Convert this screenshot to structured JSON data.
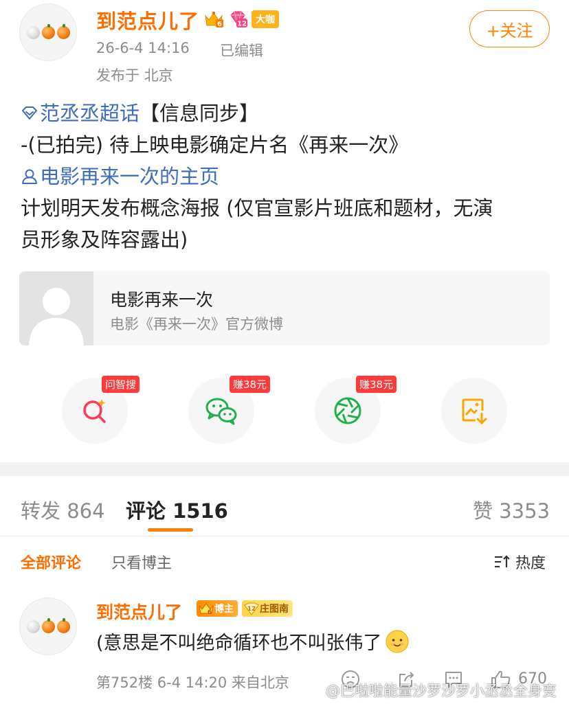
{
  "post": {
    "username": "到范点儿了",
    "badge_level": "6",
    "badge_vip": "12",
    "badge_daka": "大咖",
    "time": "26-6-4 14:16",
    "edited": "已编辑",
    "location": "发布于 北京",
    "follow_label": "+关注",
    "topic_link": "范丞丞超话",
    "line1_rest": "【信息同步】",
    "line2": "-(已拍完) 待上映电影确定片名《再来一次》",
    "user_link": "电影再来一次的主页",
    "line4": "计划明天发布概念海报 (仅官宣影片班底和题材，无演",
    "line5": "员形象及阵容露出)"
  },
  "card": {
    "title": "电影再来一次",
    "subtitle": "电影《再来一次》官方微博"
  },
  "share": {
    "badge_search": "问智搜",
    "badge_wechat": "赚38元",
    "badge_moments": "赚38元"
  },
  "tabs": {
    "repost": "转发 864",
    "comment": "评论 1516",
    "like": "赞 3353"
  },
  "filter": {
    "all": "全部评论",
    "owner": "只看博主",
    "sort": "热度"
  },
  "comment": {
    "username": "到范点儿了",
    "badge_owner": "博主",
    "badge_owner_level": "6",
    "badge_fan": "庄图南",
    "badge_fan_level": "12",
    "text": "(意思是不叫绝命循环也不叫张伟了",
    "meta": "第752楼 6-4 14:20 来自北京",
    "likes": "670"
  },
  "watermark": "@巴啦啦能量沙罗沙罗小丞丞全身变",
  "colors": {
    "accent": "#ff8200",
    "username": "#ff6d00",
    "link": "#3c6cc0",
    "badge_red": "#ff3a3a",
    "search_icon": "#ff3a5a",
    "wechat_icon": "#20b04b",
    "moments_icon": "#20b04b",
    "save_icon": "#ffa500"
  }
}
